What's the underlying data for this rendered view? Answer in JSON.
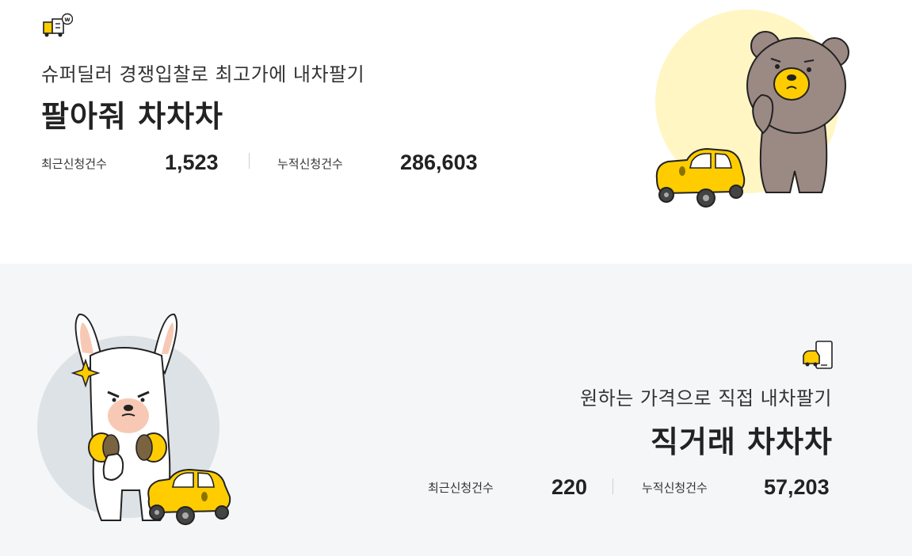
{
  "sell_service": {
    "icon": "truck-auction-icon",
    "subtitle": "슈퍼딜러 경쟁입찰로 최고가에 내차팔기",
    "title": "팔아줘 차차차",
    "recent_label": "최근신청건수",
    "recent_value": "1,523",
    "total_label": "누적신청건수",
    "total_value": "286,603",
    "illustration": "bear-with-yellow-car-illustration"
  },
  "direct_service": {
    "icon": "car-and-phone-icon",
    "subtitle": "원하는 가격으로 직접 내차팔기",
    "title": "직거래 차차차",
    "recent_label": "최근신청건수",
    "recent_value": "220",
    "total_label": "누적신청건수",
    "total_value": "57,203",
    "illustration": "alpaca-with-yellow-car-illustration"
  },
  "colors": {
    "accent_yellow": "#ffcc00",
    "top_bg": "#ffffff",
    "bottom_bg": "#f5f6f8",
    "moon_yellow": "#fff6c4",
    "circle_gray": "#dde2e6"
  }
}
